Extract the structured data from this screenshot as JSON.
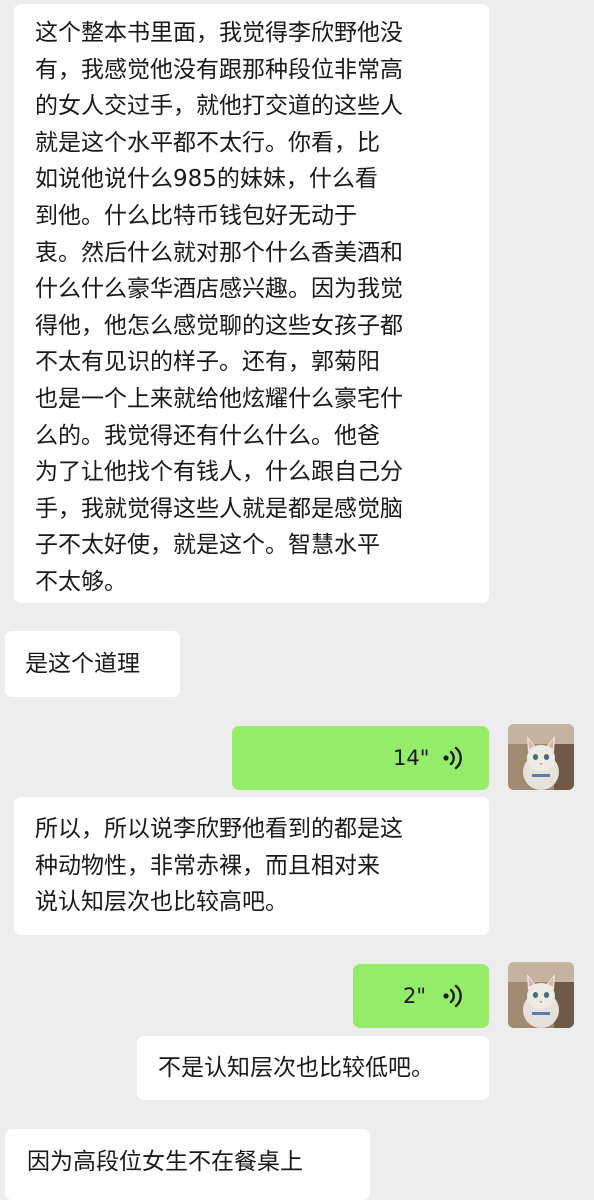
{
  "messages": [
    {
      "id": "m1",
      "sender": "other",
      "type": "text",
      "lines": [
        "这个整本书里面，我觉得李欣野他没",
        "有，我感觉他没有跟那种段位非常高",
        "的女人交过手，就他打交道的这些人",
        "就是这个水平都不太行。你看，比",
        "如说他说什么985的妹妹，什么看",
        "到他。什么比特币钱包好无动于",
        "衷。然后什么就对那个什么香美酒和",
        "什么什么豪华酒店感兴趣。因为我觉",
        "得他，他怎么感觉聊的这些女孩子都",
        "不太有见识的样子。还有，郭菊阳",
        "也是一个上来就给他炫耀什么豪宅什",
        "么的。我觉得还有什么什么。他爸",
        "为了让他找个有钱人，什么跟自己分",
        "手，我就觉得这些人就是都是感觉脑",
        "子不太好使，就是这个。智慧水平",
        "不太够。"
      ]
    },
    {
      "id": "m2",
      "sender": "other",
      "type": "text",
      "lines": [
        "是这个道理"
      ]
    },
    {
      "id": "m3",
      "sender": "me",
      "type": "voice",
      "duration": "14\"",
      "icon": "voice-wave-icon",
      "avatar": "cat-avatar"
    },
    {
      "id": "m4",
      "sender": "other",
      "type": "text",
      "lines": [
        "所以，所以说李欣野他看到的都是这",
        "种动物性，非常赤裸，而且相对来",
        "说认知层次也比较高吧。"
      ]
    },
    {
      "id": "m5",
      "sender": "me",
      "type": "voice",
      "duration": "2\"",
      "icon": "voice-wave-icon",
      "avatar": "cat-avatar"
    },
    {
      "id": "m6",
      "sender": "other",
      "type": "text",
      "lines": [
        "不是认知层次也比较低吧。"
      ]
    },
    {
      "id": "m7",
      "sender": "other",
      "type": "text",
      "lines": [
        "因为高段位女生不在餐桌上"
      ]
    }
  ],
  "colors": {
    "background": "#ededed",
    "incoming_bubble": "#ffffff",
    "outgoing_bubble": "#95ec69",
    "text": "#191919"
  }
}
